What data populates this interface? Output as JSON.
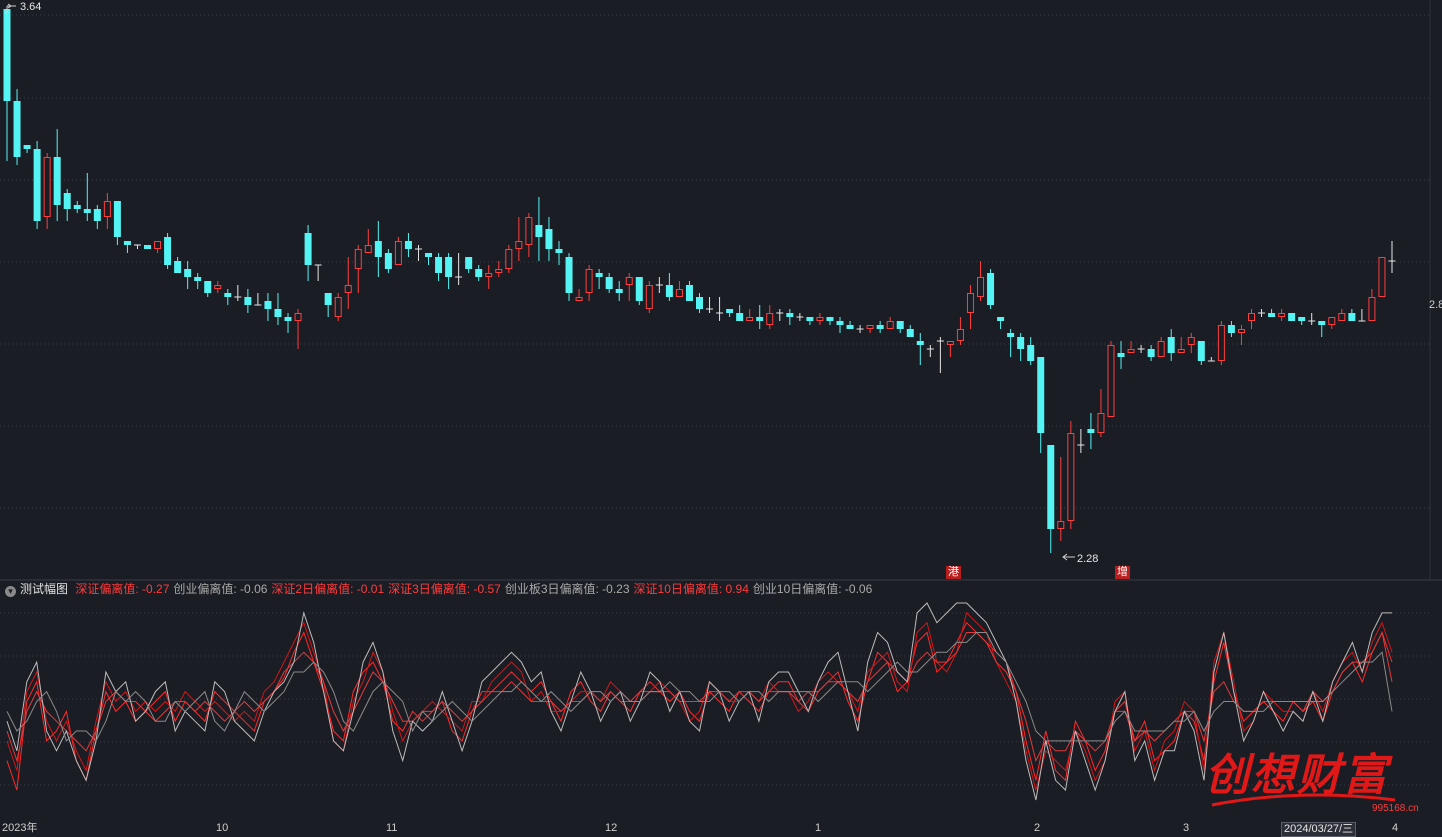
{
  "candles": [
    [
      3.64,
      3.41,
      3.26,
      3.56
    ],
    [
      3.41,
      3.27,
      3.25,
      3.44
    ],
    [
      3.3,
      3.29,
      3.28,
      3.3
    ],
    [
      3.29,
      3.11,
      3.09,
      3.31
    ],
    [
      3.12,
      3.27,
      3.09,
      3.28
    ],
    [
      3.27,
      3.15,
      3.11,
      3.34
    ],
    [
      3.18,
      3.14,
      3.11,
      3.19
    ],
    [
      3.15,
      3.14,
      3.13,
      3.16
    ],
    [
      3.14,
      3.13,
      3.11,
      3.23
    ],
    [
      3.14,
      3.11,
      3.09,
      3.15
    ],
    [
      3.12,
      3.16,
      3.09,
      3.18
    ],
    [
      3.16,
      3.07,
      3.05,
      3.16
    ],
    [
      3.06,
      3.05,
      3.03,
      3.06
    ],
    [
      3.05,
      3.05,
      3.04,
      3.05
    ],
    [
      3.05,
      3.04,
      3.04,
      3.05
    ],
    [
      3.04,
      3.06,
      3.03,
      3.06
    ],
    [
      3.07,
      3.0,
      2.99,
      3.08
    ],
    [
      3.01,
      2.98,
      2.98,
      3.02
    ],
    [
      2.99,
      2.97,
      2.94,
      3.01
    ],
    [
      2.97,
      2.96,
      2.94,
      2.98
    ],
    [
      2.96,
      2.93,
      2.92,
      2.96
    ],
    [
      2.94,
      2.95,
      2.93,
      2.96
    ],
    [
      2.93,
      2.92,
      2.9,
      2.94
    ],
    [
      2.92,
      2.92,
      2.91,
      2.95
    ],
    [
      2.92,
      2.9,
      2.88,
      2.94
    ],
    [
      2.9,
      2.9,
      2.9,
      2.93
    ],
    [
      2.91,
      2.89,
      2.86,
      2.93
    ],
    [
      2.89,
      2.87,
      2.85,
      2.93
    ],
    [
      2.87,
      2.86,
      2.83,
      2.88
    ],
    [
      2.86,
      2.88,
      2.79,
      2.89
    ],
    [
      3.08,
      3.0,
      2.96,
      3.1
    ],
    [
      3.0,
      3.0,
      2.96,
      3.0
    ],
    [
      2.93,
      2.9,
      2.87,
      2.92
    ],
    [
      2.87,
      2.92,
      2.86,
      2.93
    ],
    [
      2.93,
      2.95,
      2.89,
      3.02
    ],
    [
      2.99,
      3.04,
      2.93,
      3.05
    ],
    [
      3.03,
      3.05,
      3.03,
      3.09
    ],
    [
      3.06,
      3.02,
      2.97,
      3.11
    ],
    [
      3.03,
      2.99,
      2.98,
      3.04
    ],
    [
      3.0,
      3.06,
      3.0,
      3.07
    ],
    [
      3.06,
      3.04,
      3.02,
      3.08
    ],
    [
      3.04,
      3.04,
      3.01,
      3.05
    ],
    [
      3.03,
      3.02,
      3.0,
      3.03
    ],
    [
      3.02,
      2.98,
      2.96,
      3.03
    ],
    [
      3.02,
      2.97,
      2.94,
      3.03
    ],
    [
      2.97,
      2.97,
      2.95,
      3.03
    ],
    [
      3.02,
      2.99,
      2.98,
      3.02
    ],
    [
      2.99,
      2.97,
      2.96,
      3.0
    ],
    [
      2.97,
      2.98,
      2.94,
      3.0
    ],
    [
      2.98,
      2.99,
      2.97,
      3.01
    ],
    [
      2.99,
      3.04,
      2.98,
      3.05
    ],
    [
      3.04,
      3.06,
      3.01,
      3.12
    ],
    [
      3.05,
      3.12,
      3.02,
      3.13
    ],
    [
      3.1,
      3.07,
      3.01,
      3.17
    ],
    [
      3.09,
      3.04,
      3.01,
      3.12
    ],
    [
      3.04,
      3.03,
      3.0,
      3.06
    ],
    [
      3.02,
      2.93,
      2.91,
      3.03
    ],
    [
      2.91,
      2.92,
      2.91,
      2.94
    ],
    [
      2.93,
      2.99,
      2.91,
      3.0
    ],
    [
      2.98,
      2.97,
      2.94,
      2.99
    ],
    [
      2.97,
      2.94,
      2.93,
      2.98
    ],
    [
      2.94,
      2.93,
      2.91,
      2.96
    ],
    [
      2.95,
      2.97,
      2.91,
      2.98
    ],
    [
      2.97,
      2.91,
      2.9,
      2.97
    ],
    [
      2.89,
      2.95,
      2.88,
      2.96
    ],
    [
      2.95,
      2.95,
      2.93,
      2.97
    ],
    [
      2.95,
      2.92,
      2.91,
      2.98
    ],
    [
      2.92,
      2.94,
      2.92,
      2.96
    ],
    [
      2.95,
      2.91,
      2.91,
      2.96
    ],
    [
      2.92,
      2.89,
      2.88,
      2.93
    ],
    [
      2.89,
      2.89,
      2.88,
      2.92
    ],
    [
      2.88,
      2.88,
      2.86,
      2.92
    ],
    [
      2.89,
      2.88,
      2.87,
      2.89
    ],
    [
      2.88,
      2.86,
      2.86,
      2.9
    ],
    [
      2.86,
      2.87,
      2.86,
      2.89
    ],
    [
      2.87,
      2.86,
      2.84,
      2.9
    ],
    [
      2.85,
      2.88,
      2.84,
      2.9
    ],
    [
      2.88,
      2.88,
      2.86,
      2.89
    ],
    [
      2.88,
      2.87,
      2.85,
      2.89
    ],
    [
      2.87,
      2.87,
      2.86,
      2.88
    ],
    [
      2.87,
      2.86,
      2.85,
      2.87
    ],
    [
      2.86,
      2.87,
      2.85,
      2.88
    ],
    [
      2.87,
      2.86,
      2.85,
      2.87
    ],
    [
      2.86,
      2.85,
      2.83,
      2.87
    ],
    [
      2.85,
      2.84,
      2.84,
      2.86
    ],
    [
      2.84,
      2.84,
      2.83,
      2.85
    ],
    [
      2.84,
      2.85,
      2.83,
      2.85
    ],
    [
      2.85,
      2.84,
      2.83,
      2.86
    ],
    [
      2.84,
      2.86,
      2.84,
      2.87
    ],
    [
      2.86,
      2.84,
      2.83,
      2.86
    ],
    [
      2.84,
      2.82,
      2.82,
      2.85
    ],
    [
      2.81,
      2.8,
      2.75,
      2.83
    ],
    [
      2.79,
      2.79,
      2.77,
      2.8
    ],
    [
      2.81,
      2.81,
      2.73,
      2.82
    ],
    [
      2.8,
      2.81,
      2.77,
      2.81
    ],
    [
      2.81,
      2.84,
      2.8,
      2.87
    ],
    [
      2.88,
      2.93,
      2.84,
      2.95
    ],
    [
      2.92,
      2.97,
      2.91,
      3.01
    ],
    [
      2.98,
      2.9,
      2.89,
      2.99
    ],
    [
      2.87,
      2.86,
      2.84,
      2.87
    ],
    [
      2.83,
      2.82,
      2.77,
      2.84
    ],
    [
      2.82,
      2.79,
      2.76,
      2.83
    ],
    [
      2.8,
      2.76,
      2.75,
      2.82
    ],
    [
      2.77,
      2.58,
      2.53,
      2.77
    ],
    [
      2.55,
      2.34,
      2.28,
      2.55
    ],
    [
      2.34,
      2.36,
      2.31,
      2.52
    ],
    [
      2.36,
      2.58,
      2.34,
      2.61
    ],
    [
      2.55,
      2.55,
      2.53,
      2.59
    ],
    [
      2.59,
      2.58,
      2.54,
      2.63
    ],
    [
      2.58,
      2.63,
      2.57,
      2.69
    ],
    [
      2.62,
      2.8,
      2.62,
      2.81
    ],
    [
      2.78,
      2.77,
      2.74,
      2.81
    ],
    [
      2.78,
      2.79,
      2.78,
      2.81
    ],
    [
      2.79,
      2.79,
      2.78,
      2.8
    ],
    [
      2.79,
      2.77,
      2.76,
      2.8
    ],
    [
      2.77,
      2.81,
      2.77,
      2.82
    ],
    [
      2.82,
      2.78,
      2.76,
      2.84
    ],
    [
      2.78,
      2.79,
      2.78,
      2.82
    ],
    [
      2.8,
      2.82,
      2.78,
      2.83
    ],
    [
      2.81,
      2.76,
      2.75,
      2.81
    ],
    [
      2.76,
      2.76,
      2.76,
      2.77
    ],
    [
      2.76,
      2.85,
      2.75,
      2.86
    ],
    [
      2.85,
      2.83,
      2.82,
      2.86
    ],
    [
      2.83,
      2.84,
      2.8,
      2.85
    ],
    [
      2.86,
      2.88,
      2.84,
      2.89
    ],
    [
      2.88,
      2.88,
      2.87,
      2.89
    ],
    [
      2.88,
      2.87,
      2.87,
      2.89
    ],
    [
      2.87,
      2.88,
      2.86,
      2.89
    ],
    [
      2.88,
      2.86,
      2.86,
      2.88
    ],
    [
      2.87,
      2.86,
      2.85,
      2.87
    ],
    [
      2.86,
      2.86,
      2.85,
      2.88
    ],
    [
      2.86,
      2.85,
      2.82,
      2.86
    ],
    [
      2.85,
      2.87,
      2.84,
      2.87
    ],
    [
      2.86,
      2.88,
      2.86,
      2.89
    ],
    [
      2.88,
      2.86,
      2.86,
      2.89
    ],
    [
      2.86,
      2.86,
      2.86,
      2.89
    ],
    [
      2.86,
      2.92,
      2.86,
      2.94
    ],
    [
      2.92,
      3.02,
      2.92,
      3.02
    ],
    [
      3.01,
      3.01,
      2.98,
      3.06
    ]
  ],
  "ind_series": [
    {
      "color": "#ff2a2a",
      "values": [
        0.2,
        0.05,
        0.5,
        0.6,
        0.3,
        0.35,
        0.45,
        0.2,
        0.1,
        0.35,
        0.55,
        0.45,
        0.5,
        0.4,
        0.45,
        0.5,
        0.55,
        0.4,
        0.5,
        0.45,
        0.4,
        0.55,
        0.5,
        0.45,
        0.4,
        0.35,
        0.5,
        0.55,
        0.62,
        0.75,
        0.85,
        0.7,
        0.55,
        0.35,
        0.3,
        0.55,
        0.65,
        0.7,
        0.6,
        0.4,
        0.35,
        0.45,
        0.4,
        0.45,
        0.5,
        0.35,
        0.3,
        0.45,
        0.55,
        0.55,
        0.6,
        0.65,
        0.6,
        0.55,
        0.6,
        0.5,
        0.4,
        0.55,
        0.6,
        0.5,
        0.45,
        0.55,
        0.5,
        0.45,
        0.55,
        0.6,
        0.55,
        0.5,
        0.55,
        0.45,
        0.4,
        0.55,
        0.5,
        0.45,
        0.55,
        0.5,
        0.45,
        0.55,
        0.6,
        0.6,
        0.5,
        0.45,
        0.55,
        0.6,
        0.65,
        0.5,
        0.4,
        0.6,
        0.75,
        0.7,
        0.55,
        0.6,
        0.8,
        0.85,
        0.65,
        0.7,
        0.8,
        0.9,
        0.85,
        0.8,
        0.75,
        0.7,
        0.55,
        0.3,
        0.1,
        0.35,
        0.15,
        0.1,
        0.4,
        0.3,
        0.15,
        0.25,
        0.45,
        0.5,
        0.3,
        0.4,
        0.2,
        0.25,
        0.3,
        0.45,
        0.4,
        0.2,
        0.6,
        0.8,
        0.55,
        0.4,
        0.45,
        0.5,
        0.45,
        0.4,
        0.5,
        0.45,
        0.5,
        0.4,
        0.55,
        0.65,
        0.7,
        0.6,
        0.75,
        0.85,
        0.7
      ]
    },
    {
      "color": "#d41616",
      "values": [
        0.3,
        0.15,
        0.55,
        0.65,
        0.4,
        0.3,
        0.4,
        0.25,
        0.15,
        0.4,
        0.6,
        0.5,
        0.55,
        0.45,
        0.5,
        0.45,
        0.5,
        0.45,
        0.55,
        0.5,
        0.45,
        0.5,
        0.45,
        0.4,
        0.45,
        0.4,
        0.55,
        0.6,
        0.7,
        0.8,
        0.9,
        0.75,
        0.6,
        0.3,
        0.25,
        0.5,
        0.6,
        0.75,
        0.65,
        0.45,
        0.3,
        0.4,
        0.45,
        0.5,
        0.45,
        0.4,
        0.35,
        0.5,
        0.5,
        0.6,
        0.65,
        0.7,
        0.65,
        0.5,
        0.55,
        0.45,
        0.45,
        0.5,
        0.55,
        0.55,
        0.5,
        0.6,
        0.55,
        0.5,
        0.5,
        0.55,
        0.6,
        0.55,
        0.5,
        0.4,
        0.45,
        0.6,
        0.55,
        0.5,
        0.5,
        0.55,
        0.5,
        0.6,
        0.55,
        0.55,
        0.45,
        0.5,
        0.6,
        0.65,
        0.6,
        0.55,
        0.45,
        0.65,
        0.7,
        0.75,
        0.6,
        0.55,
        0.85,
        0.9,
        0.7,
        0.65,
        0.75,
        0.95,
        0.9,
        0.85,
        0.7,
        0.6,
        0.5,
        0.25,
        0.05,
        0.25,
        0.2,
        0.15,
        0.35,
        0.25,
        0.1,
        0.2,
        0.5,
        0.55,
        0.25,
        0.35,
        0.15,
        0.3,
        0.35,
        0.5,
        0.45,
        0.15,
        0.7,
        0.85,
        0.6,
        0.35,
        0.4,
        0.55,
        0.5,
        0.45,
        0.45,
        0.4,
        0.55,
        0.45,
        0.6,
        0.7,
        0.75,
        0.65,
        0.8,
        0.9,
        0.75
      ]
    },
    {
      "color": "#e23a3a",
      "values": [
        0.35,
        0.2,
        0.45,
        0.55,
        0.45,
        0.4,
        0.35,
        0.3,
        0.25,
        0.35,
        0.5,
        0.55,
        0.5,
        0.5,
        0.45,
        0.4,
        0.45,
        0.5,
        0.5,
        0.45,
        0.5,
        0.45,
        0.4,
        0.45,
        0.5,
        0.45,
        0.5,
        0.55,
        0.65,
        0.7,
        0.75,
        0.7,
        0.6,
        0.45,
        0.35,
        0.45,
        0.55,
        0.65,
        0.6,
        0.5,
        0.4,
        0.4,
        0.45,
        0.45,
        0.5,
        0.45,
        0.4,
        0.45,
        0.5,
        0.55,
        0.55,
        0.6,
        0.55,
        0.5,
        0.5,
        0.5,
        0.45,
        0.5,
        0.5,
        0.55,
        0.5,
        0.55,
        0.5,
        0.5,
        0.55,
        0.55,
        0.55,
        0.55,
        0.5,
        0.5,
        0.5,
        0.55,
        0.55,
        0.5,
        0.55,
        0.55,
        0.5,
        0.55,
        0.55,
        0.55,
        0.5,
        0.55,
        0.55,
        0.6,
        0.6,
        0.55,
        0.5,
        0.6,
        0.65,
        0.7,
        0.65,
        0.6,
        0.7,
        0.75,
        0.7,
        0.7,
        0.75,
        0.85,
        0.85,
        0.8,
        0.7,
        0.65,
        0.55,
        0.4,
        0.2,
        0.3,
        0.25,
        0.25,
        0.35,
        0.3,
        0.25,
        0.3,
        0.45,
        0.45,
        0.3,
        0.35,
        0.3,
        0.35,
        0.4,
        0.45,
        0.45,
        0.3,
        0.55,
        0.6,
        0.5,
        0.45,
        0.45,
        0.5,
        0.5,
        0.5,
        0.5,
        0.45,
        0.55,
        0.5,
        0.55,
        0.65,
        0.7,
        0.7,
        0.75,
        0.85,
        0.6
      ]
    },
    {
      "color": "#bcbcbc",
      "values": [
        0.4,
        0.25,
        0.6,
        0.7,
        0.35,
        0.25,
        0.35,
        0.2,
        0.1,
        0.3,
        0.65,
        0.55,
        0.6,
        0.4,
        0.45,
        0.55,
        0.6,
        0.35,
        0.45,
        0.4,
        0.35,
        0.6,
        0.55,
        0.4,
        0.35,
        0.3,
        0.45,
        0.55,
        0.6,
        0.7,
        0.95,
        0.8,
        0.55,
        0.3,
        0.25,
        0.45,
        0.7,
        0.8,
        0.65,
        0.35,
        0.2,
        0.4,
        0.35,
        0.4,
        0.55,
        0.4,
        0.25,
        0.4,
        0.6,
        0.65,
        0.7,
        0.75,
        0.7,
        0.6,
        0.65,
        0.45,
        0.35,
        0.5,
        0.65,
        0.55,
        0.4,
        0.5,
        0.55,
        0.4,
        0.5,
        0.65,
        0.6,
        0.45,
        0.55,
        0.4,
        0.35,
        0.6,
        0.55,
        0.4,
        0.5,
        0.55,
        0.4,
        0.6,
        0.65,
        0.65,
        0.55,
        0.45,
        0.6,
        0.7,
        0.75,
        0.55,
        0.35,
        0.7,
        0.85,
        0.8,
        0.65,
        0.6,
        0.95,
        1.0,
        0.9,
        0.95,
        1.0,
        1.0,
        0.95,
        0.9,
        0.8,
        0.7,
        0.5,
        0.2,
        0.0,
        0.3,
        0.1,
        0.05,
        0.35,
        0.2,
        0.05,
        0.2,
        0.45,
        0.55,
        0.2,
        0.3,
        0.1,
        0.25,
        0.25,
        0.45,
        0.35,
        0.1,
        0.65,
        0.85,
        0.55,
        0.3,
        0.4,
        0.55,
        0.45,
        0.35,
        0.45,
        0.4,
        0.55,
        0.4,
        0.6,
        0.7,
        0.8,
        0.65,
        0.85,
        0.95,
        0.95
      ]
    },
    {
      "color": "#8a8a8a",
      "values": [
        0.45,
        0.35,
        0.4,
        0.5,
        0.55,
        0.45,
        0.3,
        0.35,
        0.35,
        0.3,
        0.4,
        0.55,
        0.5,
        0.55,
        0.5,
        0.4,
        0.4,
        0.5,
        0.45,
        0.5,
        0.55,
        0.4,
        0.35,
        0.45,
        0.55,
        0.5,
        0.45,
        0.5,
        0.55,
        0.65,
        0.65,
        0.7,
        0.65,
        0.55,
        0.4,
        0.35,
        0.45,
        0.55,
        0.6,
        0.55,
        0.5,
        0.35,
        0.45,
        0.4,
        0.45,
        0.5,
        0.45,
        0.4,
        0.45,
        0.5,
        0.55,
        0.55,
        0.6,
        0.55,
        0.5,
        0.55,
        0.5,
        0.45,
        0.5,
        0.55,
        0.55,
        0.5,
        0.55,
        0.5,
        0.5,
        0.55,
        0.55,
        0.6,
        0.55,
        0.55,
        0.5,
        0.5,
        0.55,
        0.55,
        0.5,
        0.55,
        0.55,
        0.5,
        0.55,
        0.55,
        0.55,
        0.55,
        0.5,
        0.55,
        0.6,
        0.6,
        0.6,
        0.55,
        0.6,
        0.65,
        0.7,
        0.65,
        0.65,
        0.7,
        0.75,
        0.75,
        0.8,
        0.8,
        0.85,
        0.85,
        0.75,
        0.7,
        0.6,
        0.5,
        0.35,
        0.3,
        0.3,
        0.3,
        0.3,
        0.3,
        0.3,
        0.3,
        0.4,
        0.45,
        0.35,
        0.35,
        0.35,
        0.35,
        0.4,
        0.4,
        0.45,
        0.35,
        0.45,
        0.5,
        0.5,
        0.45,
        0.45,
        0.45,
        0.5,
        0.5,
        0.5,
        0.5,
        0.5,
        0.5,
        0.55,
        0.6,
        0.65,
        0.7,
        0.7,
        0.75,
        0.45
      ]
    }
  ],
  "price_labels": {
    "high": "3.64",
    "low": "2.28",
    "right_cut": "2.8"
  },
  "indicator": {
    "title": "测试幅图",
    "items": [
      {
        "text": "深证偏离值: -0.27",
        "color": "red"
      },
      {
        "text": "创业偏离值: -0.06",
        "color": "grey"
      },
      {
        "text": "深证2日偏离值: -0.01",
        "color": "red"
      },
      {
        "text": "深证3日偏离值: -0.57",
        "color": "red"
      },
      {
        "text": "创业板3日偏离值: -0.23",
        "color": "grey"
      },
      {
        "text": "深证10日偏离值: 0.94",
        "color": "red"
      },
      {
        "text": "创业10日偏离值: -0.06",
        "color": "grey"
      }
    ]
  },
  "markers": {
    "gang": "港",
    "zeng": "增"
  },
  "xaxis": {
    "y2023": "2023年",
    "m10": "10",
    "m11": "11",
    "m12": "12",
    "m1": "1",
    "m2": "2",
    "m3": "3",
    "date": "2024/03/27/三",
    "m4": "4"
  },
  "watermark": {
    "brand": "创想财富",
    "url": "995168.cn"
  },
  "colors": {
    "up": "#ff3d3d",
    "down": "#54f4f4",
    "bg": "#1b1d24"
  }
}
